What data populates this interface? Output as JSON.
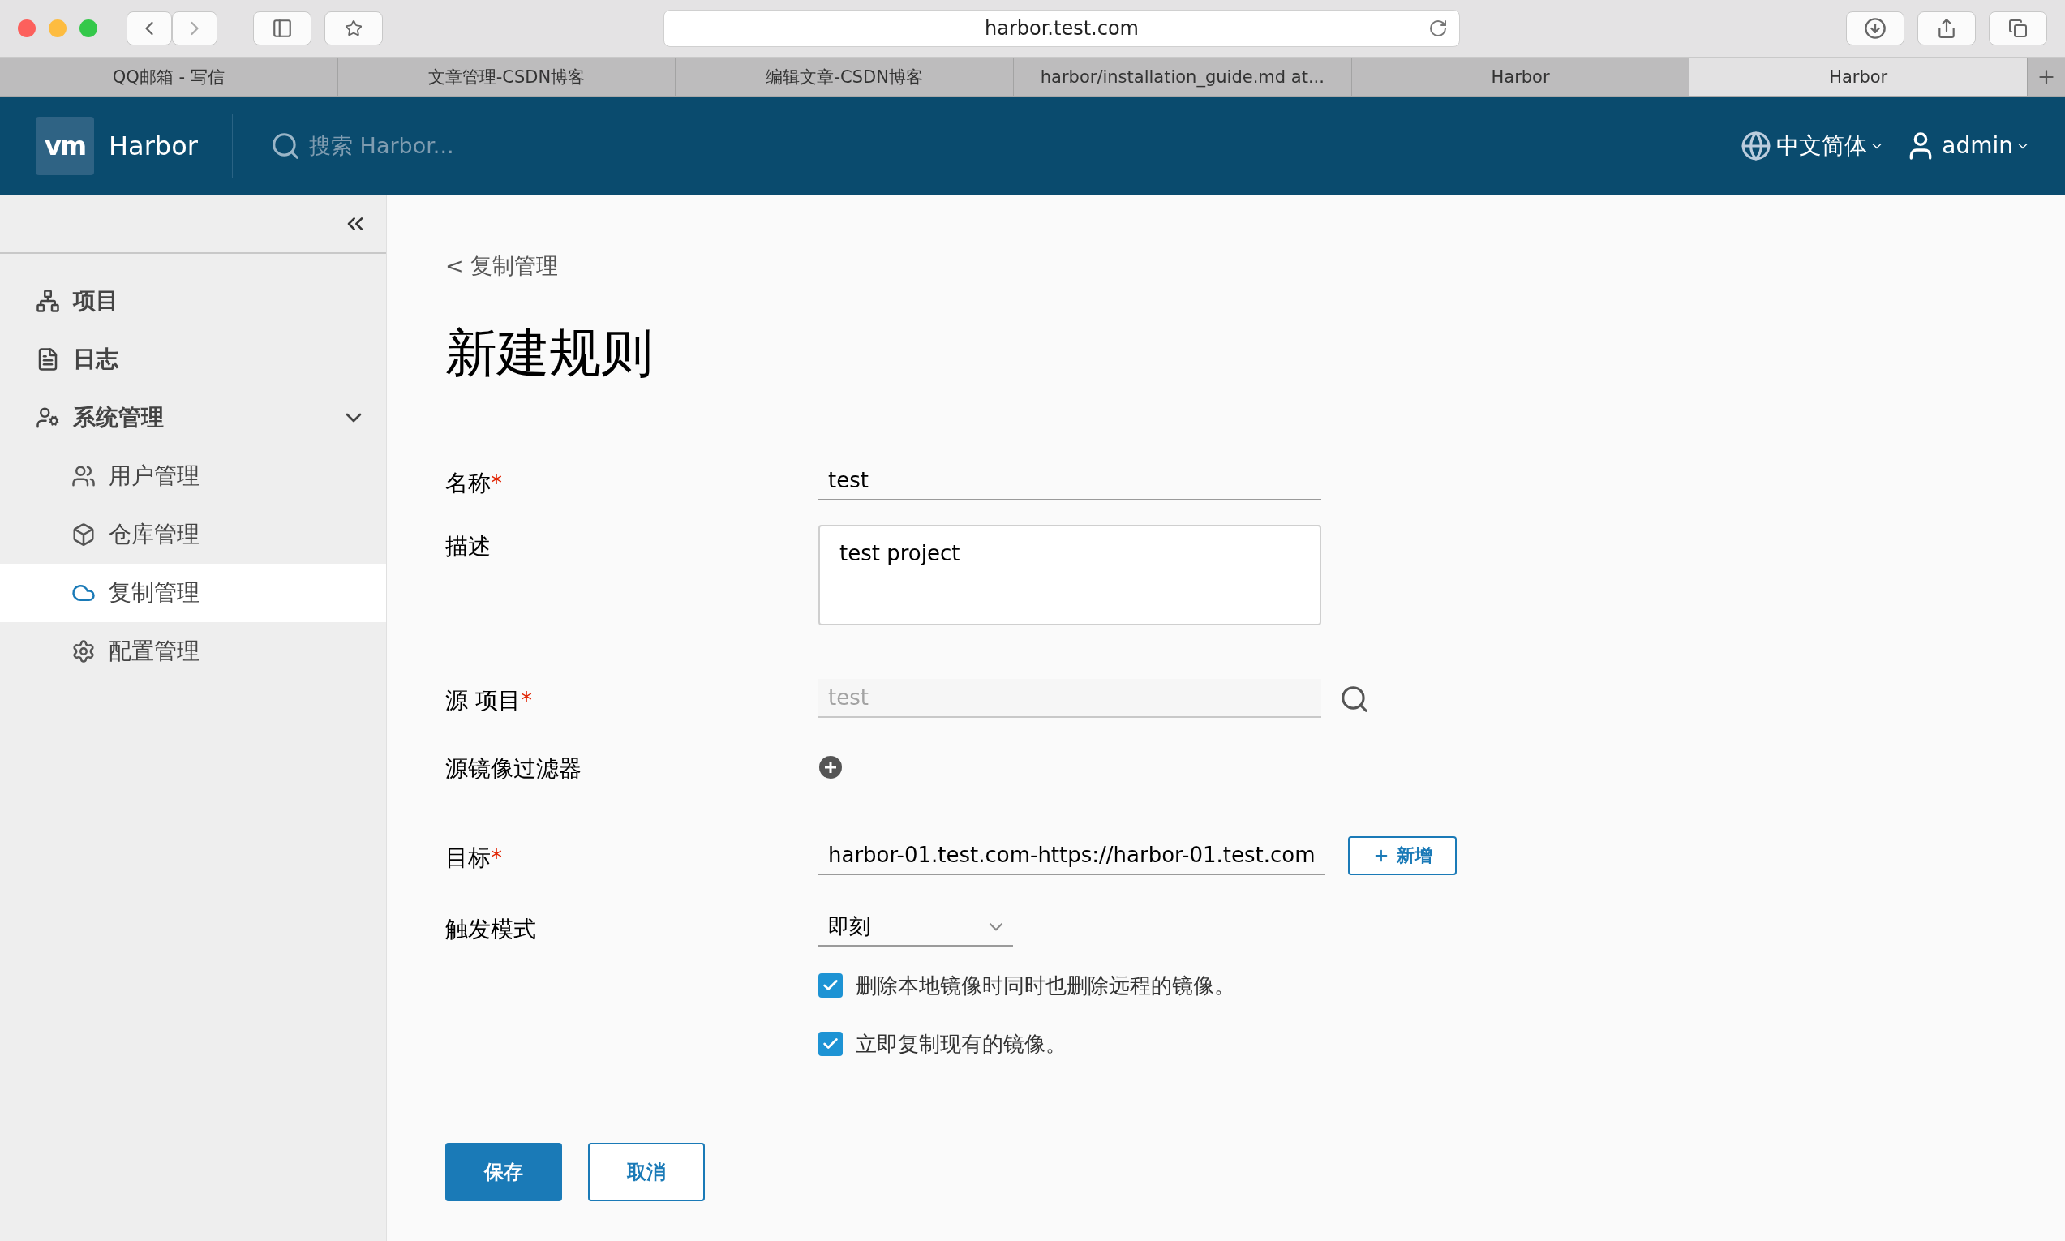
{
  "browser": {
    "url": "harbor.test.com",
    "tabs": [
      {
        "label": "QQ邮箱 - 写信",
        "selected": false
      },
      {
        "label": "文章管理-CSDN博客",
        "selected": false
      },
      {
        "label": "编辑文章-CSDN博客",
        "selected": false
      },
      {
        "label": "harbor/installation_guide.md at...",
        "selected": false
      },
      {
        "label": "Harbor",
        "selected": false
      },
      {
        "label": "Harbor",
        "selected": true
      }
    ]
  },
  "header": {
    "logo": "vm",
    "title": "Harbor",
    "search_placeholder": "搜索 Harbor...",
    "language": "中文简体",
    "user": "admin"
  },
  "sidebar": {
    "items": [
      {
        "label": "项目",
        "selected": false
      },
      {
        "label": "日志",
        "selected": false
      },
      {
        "label": "系统管理",
        "selected": false,
        "expanded": true,
        "children": [
          {
            "label": "用户管理",
            "selected": false
          },
          {
            "label": "仓库管理",
            "selected": false
          },
          {
            "label": "复制管理",
            "selected": true
          },
          {
            "label": "配置管理",
            "selected": false
          }
        ]
      }
    ]
  },
  "required_mark": "*",
  "breadcrumb": "< 复制管理",
  "title": "新建规则",
  "fields": [
    {
      "kind": "text",
      "label": "名称",
      "required": true,
      "value": "test"
    },
    {
      "kind": "textarea",
      "label": "描述",
      "required": false,
      "value": "test project"
    },
    {
      "kind": "search",
      "label": "源 项目",
      "required": true,
      "placeholder": "test"
    },
    {
      "kind": "add",
      "label": "源镜像过滤器",
      "required": false
    },
    {
      "kind": "target",
      "label": "目标",
      "required": true,
      "value": "harbor-01.test.com-https://harbor-01.test.com",
      "button": "新增"
    },
    {
      "kind": "select",
      "label": "触发模式",
      "required": false,
      "value": "即刻"
    }
  ],
  "options": [
    {
      "label": "删除本地镜像时同时也删除远程的镜像。",
      "checked": true
    },
    {
      "label": "立即复制现有的镜像。",
      "checked": true
    }
  ],
  "buttons": [
    {
      "label": "保存",
      "kind": "primary"
    },
    {
      "label": "取消",
      "kind": "secondary"
    }
  ]
}
